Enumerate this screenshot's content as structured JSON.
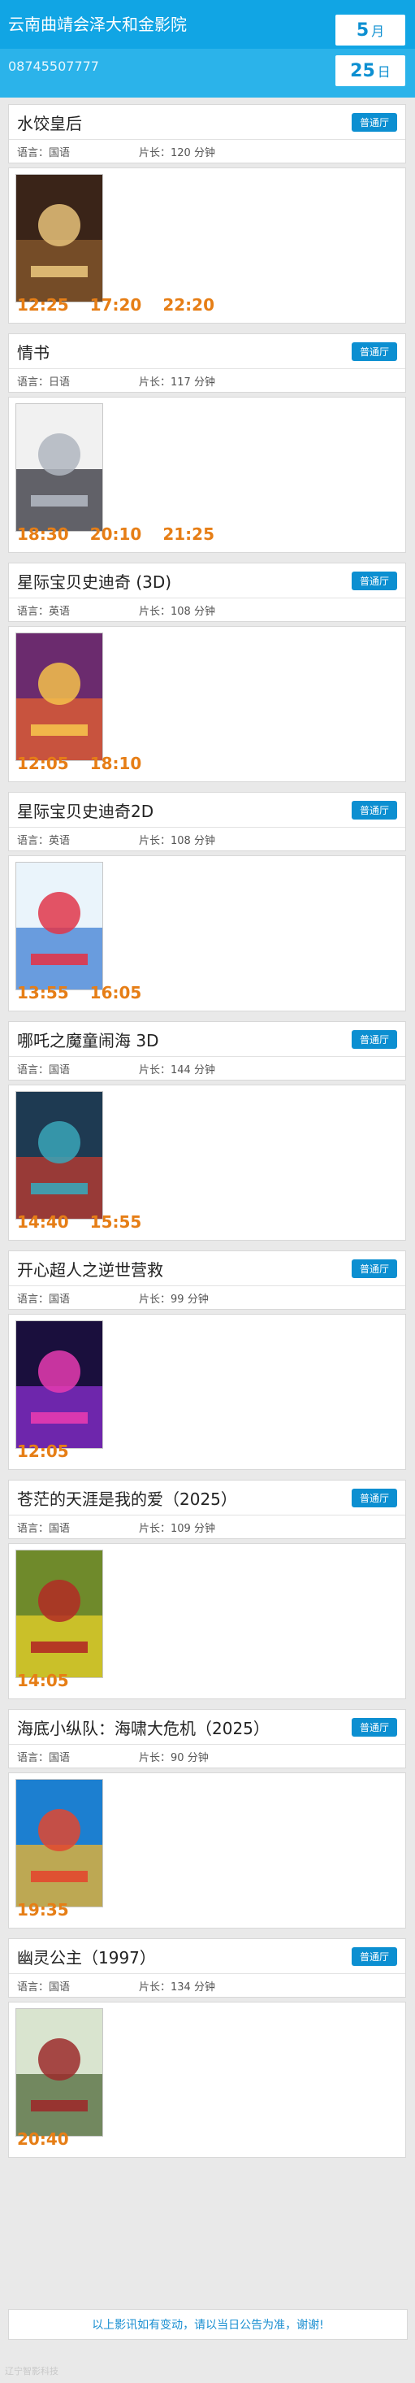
{
  "header": {
    "cinema_name": "云南曲靖会泽大和金影院",
    "phone": "08745507777",
    "month": "5",
    "month_unit": "月",
    "day": "25",
    "day_unit": "日"
  },
  "labels": {
    "language": "语言：",
    "duration": "片长：",
    "minutes": "分钟"
  },
  "movies": [
    {
      "title": "水饺皇后",
      "hall": "普通厅",
      "language": "国语",
      "duration": "120",
      "times": [
        "12:25",
        "17:20",
        "22:20"
      ],
      "poster_colors": [
        "#3a2418",
        "#8a5a2c",
        "#e7c27a"
      ]
    },
    {
      "title": "情书",
      "hall": "普通厅",
      "language": "日语",
      "duration": "117",
      "times": [
        "18:30",
        "20:10",
        "21:25"
      ],
      "poster_colors": [
        "#f1f1f1",
        "#30303a",
        "#b0b6c0"
      ]
    },
    {
      "title": "星际宝贝史迪奇 (3D)",
      "hall": "普通厅",
      "language": "英语",
      "duration": "108",
      "times": [
        "12:05",
        "18:10"
      ],
      "poster_colors": [
        "#6b2b6e",
        "#e7622f",
        "#f5c14b"
      ]
    },
    {
      "title": "星际宝贝史迪奇2D",
      "hall": "普通厅",
      "language": "英语",
      "duration": "108",
      "times": [
        "13:55",
        "16:05"
      ],
      "poster_colors": [
        "#eaf4fb",
        "#3d7fd4",
        "#e0364a"
      ]
    },
    {
      "title": "哪吒之魔童闹海 3D",
      "hall": "普通厅",
      "language": "国语",
      "duration": "144",
      "times": [
        "14:40",
        "15:55"
      ],
      "poster_colors": [
        "#1e3a52",
        "#c23b2f",
        "#3aa6b8"
      ]
    },
    {
      "title": "开心超人之逆世营救",
      "hall": "普通厅",
      "language": "国语",
      "duration": "99",
      "times": [
        "12:05"
      ],
      "poster_colors": [
        "#1a0f3d",
        "#8b2fd1",
        "#e63bb0"
      ]
    },
    {
      "title": "苍茫的天涯是我的爱（2025）",
      "hall": "普通厅",
      "language": "国语",
      "duration": "109",
      "times": [
        "14:05"
      ],
      "poster_colors": [
        "#6f8a2b",
        "#e8d229",
        "#b32a24"
      ]
    },
    {
      "title": "海底小纵队：海啸大危机（2025）",
      "hall": "普通厅",
      "language": "国语",
      "duration": "90",
      "times": [
        "19:35"
      ],
      "poster_colors": [
        "#1c7fd0",
        "#f3b52a",
        "#e2472f"
      ]
    },
    {
      "title": "幽灵公主（1997）",
      "hall": "普通厅",
      "language": "国语",
      "duration": "134",
      "times": [
        "20:40"
      ],
      "poster_colors": [
        "#d9e4cf",
        "#4f6a3a",
        "#9b2b2b"
      ]
    }
  ],
  "footer": {
    "notice": "以上影讯如有变动，请以当日公告为准，谢谢!",
    "powered": "辽宁智影科技"
  }
}
